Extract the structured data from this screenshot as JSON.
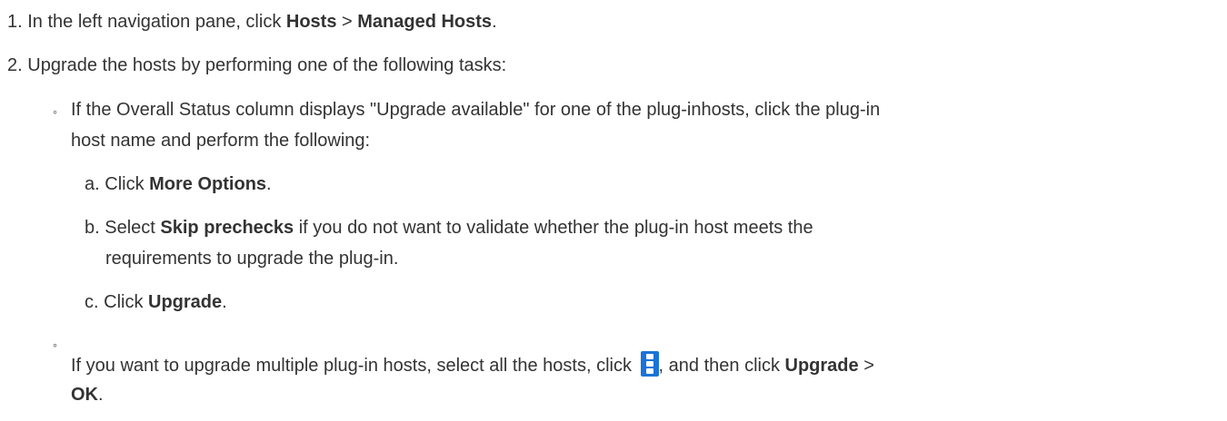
{
  "steps": [
    {
      "marker": "1.",
      "pre": "In the left navigation pane, click ",
      "bold1": "Hosts",
      "mid": " > ",
      "bold2": "Managed Hosts",
      "post": "."
    },
    {
      "marker": "2.",
      "text": "Upgrade the hosts by performing one of the following tasks:"
    }
  ],
  "bullet_marker": "◦",
  "option1": {
    "line1": "If the Overall Status column displays \"Upgrade available\" for one of the plug-inhosts, click the plug-in",
    "line2": "host name and perform the following:",
    "substeps": [
      {
        "marker": "a.",
        "pre": "Click ",
        "bold": "More Options",
        "post": "."
      },
      {
        "marker": "b.",
        "pre": "Select ",
        "bold": "Skip prechecks",
        "post": " if you do not want to validate whether the plug-in host meets the",
        "cont": "requirements to upgrade the plug-in."
      },
      {
        "marker": "c.",
        "pre": "Click ",
        "bold": "Upgrade",
        "post": "."
      }
    ]
  },
  "option2": {
    "pre": "If you want to upgrade multiple plug-in hosts, select all the hosts, click ",
    "icon": "kebab-menu-icon",
    "mid": ", and then click ",
    "bold1": "Upgrade",
    "sep": " >",
    "bold2": "OK",
    "post": "."
  },
  "colors": {
    "text": "#333333",
    "icon": "#1a73d9"
  }
}
